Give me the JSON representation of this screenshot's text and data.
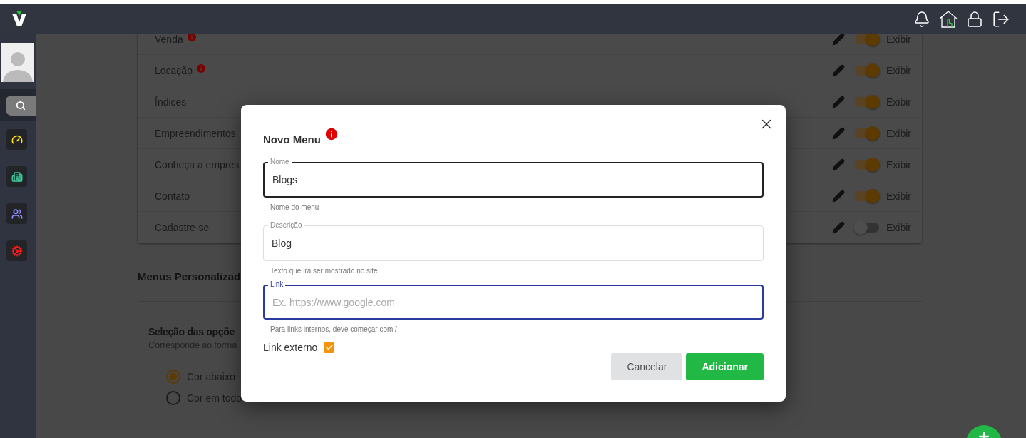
{
  "menu_items": [
    {
      "label": "Venda",
      "info": true,
      "shown": true,
      "toggle_label": "Exibir"
    },
    {
      "label": "Locação",
      "info": true,
      "shown": true,
      "toggle_label": "Exibir"
    },
    {
      "label": "Índices",
      "info": false,
      "shown": true,
      "toggle_label": "Exibir"
    },
    {
      "label": "Empreendimentos",
      "info": false,
      "shown": true,
      "toggle_label": "Exibir"
    },
    {
      "label": "Conheça a empres",
      "info": false,
      "shown": true,
      "toggle_label": "Exibir"
    },
    {
      "label": "Contato",
      "info": false,
      "shown": true,
      "toggle_label": "Exibir"
    },
    {
      "label": "Cadastre-se",
      "info": false,
      "shown": false,
      "toggle_label": "Exibir"
    }
  ],
  "custom_menus": {
    "title": "Menus Personalizad"
  },
  "options_section": {
    "title": "Seleção das opçõe",
    "description": "Corresponde ao forma",
    "options": [
      {
        "label": "Cor abaixo",
        "selected": true
      },
      {
        "label": "Cor em todo",
        "selected": false
      }
    ]
  },
  "dialog": {
    "title": "Novo Menu",
    "fields": [
      {
        "label": "Nome",
        "value": "Blogs",
        "helper": "Nome do menu",
        "focused": false,
        "hovered": true
      },
      {
        "label": "Descrição",
        "value": "Blog",
        "helper": "Texto que irá ser mostrado no site",
        "focused": false,
        "hovered": false
      },
      {
        "label": "Link",
        "placeholder": "Ex. https://www.google.com",
        "helper": "Para links internos, deve começar com /",
        "focused": true,
        "hovered": false
      }
    ],
    "checkbox": {
      "label": "Link externo",
      "checked": true
    },
    "buttons": [
      {
        "label": "Cancelar",
        "kind": "secondary"
      },
      {
        "label": "Adicionar",
        "kind": "primary"
      }
    ]
  }
}
